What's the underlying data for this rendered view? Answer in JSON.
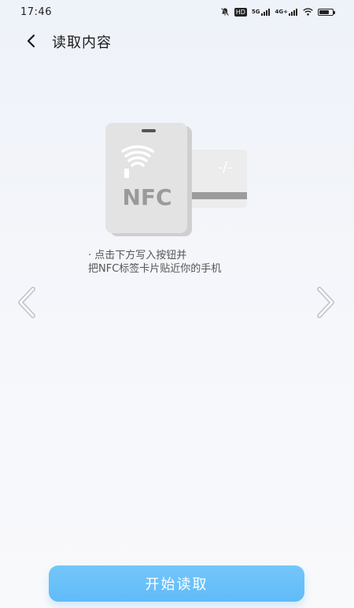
{
  "status_bar": {
    "time": "17:46",
    "hd_label": "HD",
    "signal_1_label": "5G",
    "signal_2_label": "4G+",
    "battery_level": 0.75
  },
  "header": {
    "title": "读取内容",
    "back_icon": "chevron-left-icon"
  },
  "illustration": {
    "label": "NFC",
    "phone_color": "#e3e3e3",
    "card_color": "#eaeaea",
    "stripe_color": "#9c9c9c"
  },
  "instructions": {
    "line1": "· 点击下方写入按钮并",
    "line2": "把NFC标签卡片贴近你的手机"
  },
  "navigation": {
    "prev_icon": "chevron-left-icon",
    "next_icon": "chevron-right-icon"
  },
  "actions": {
    "start_label": "开始读取",
    "accent_color": "#63bdf8"
  }
}
